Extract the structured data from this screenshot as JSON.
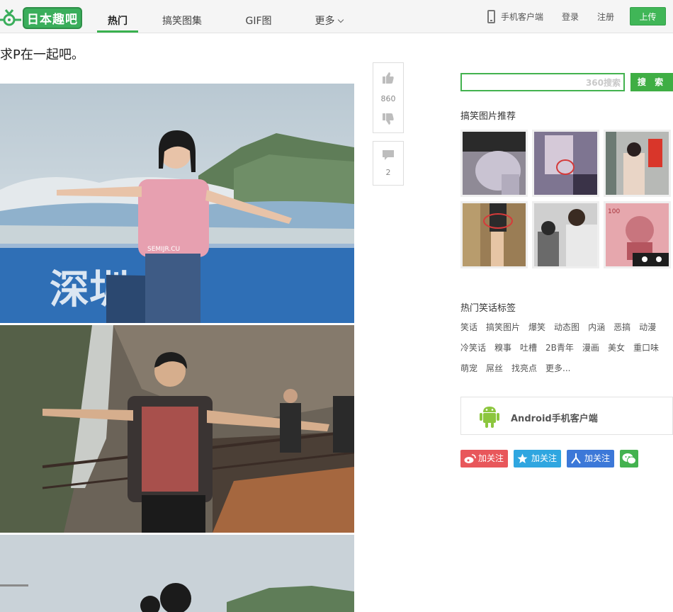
{
  "header": {
    "logo_text": "日本趣吧",
    "nav": [
      {
        "label": "热门",
        "active": true
      },
      {
        "label": "搞笑图集",
        "active": false
      },
      {
        "label": "GIF图",
        "active": false
      },
      {
        "label": "更多",
        "active": false
      }
    ],
    "mobile_client": "手机客户端",
    "login": "登录",
    "register": "注册",
    "upload": "上传"
  },
  "post": {
    "title": "求P在一起吧。",
    "likes": "860",
    "comments": "2",
    "photo_text": "深圳小",
    "photo_watermark": "SEMIJR.CU"
  },
  "sidebar": {
    "search_placeholder": "",
    "search_brand": "360搜索",
    "search_button": "搜 索",
    "recommend_title": "搞笑图片推荐",
    "tags_title": "热门笑话标签",
    "tags": [
      [
        "笑话",
        "搞笑图片",
        "爆笑",
        "动态图",
        "内涵",
        "恶搞",
        "动漫"
      ],
      [
        "冷笑话",
        "糗事",
        "吐槽",
        "2B青年",
        "漫画",
        "美女",
        "重口味"
      ],
      [
        "萌宠",
        "屌丝",
        "找亮点",
        "更多..."
      ]
    ],
    "android_label": "Android手机客户端",
    "follow": [
      {
        "label": "加关注",
        "network": "weibo-icon",
        "color": "#e8575b"
      },
      {
        "label": "加关注",
        "network": "qzone-icon",
        "color": "#2fa6e0"
      },
      {
        "label": "加关注",
        "network": "renren-icon",
        "color": "#3c78d8"
      },
      {
        "label": "",
        "network": "wechat-icon",
        "color": "#43b24f"
      }
    ]
  },
  "colors": {
    "accent": "#39b14f",
    "header_bg": "#f5f5f5"
  }
}
